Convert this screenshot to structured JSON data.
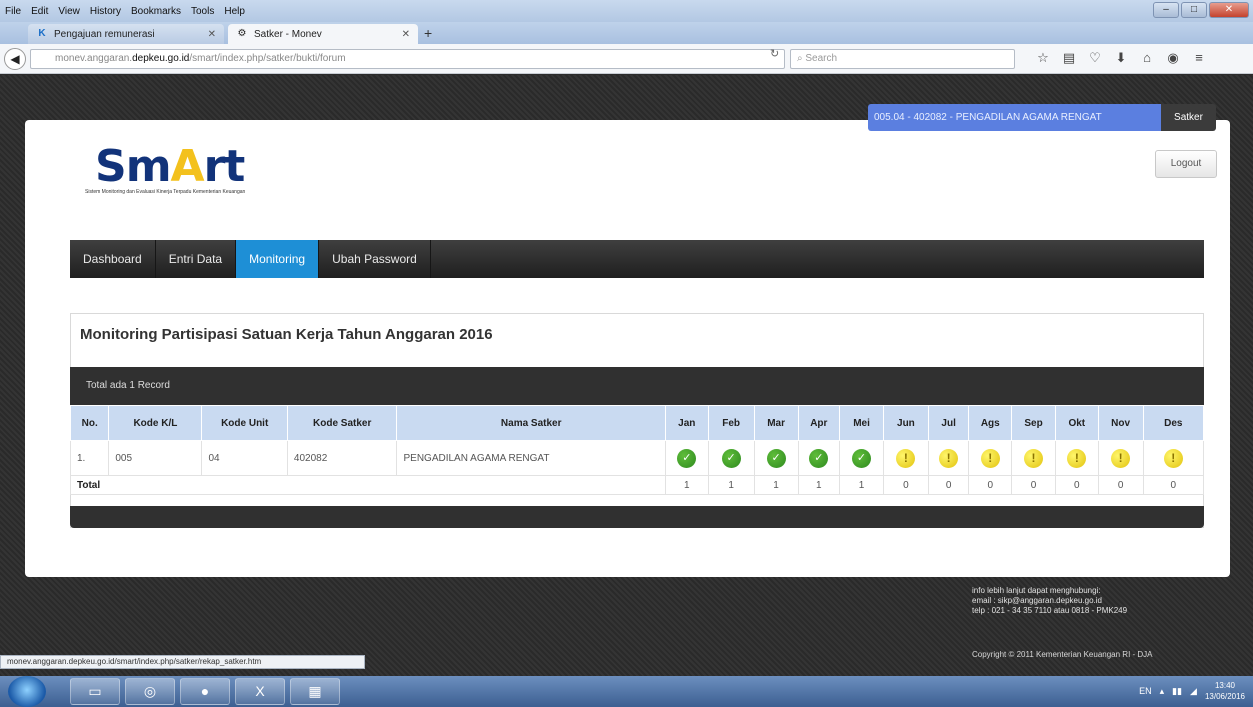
{
  "browser": {
    "menu": [
      "File",
      "Edit",
      "View",
      "History",
      "Bookmarks",
      "Tools",
      "Help"
    ],
    "tabs": [
      {
        "label": "Pengajuan remunerasi",
        "active": false
      },
      {
        "label": "Satker - Monev",
        "active": true
      }
    ],
    "url_prefix": "monev.anggaran.",
    "url_domain": "depkeu.go.id",
    "url_path": "/smart/index.php/satker/bukti/forum",
    "search_placeholder": "Search"
  },
  "header": {
    "satker_badge": "005.04 - 402082 - PENGADILAN AGAMA RENGAT",
    "role": "Satker",
    "logout": "Logout"
  },
  "logo": {
    "text_left": "Sm",
    "text_star": "A",
    "text_right": "rt",
    "subtitle": "Sistem Monitoring dan Evaluasi Kinerja Terpadu Kementerian Keuangan"
  },
  "nav": {
    "items": [
      "Dashboard",
      "Entri Data",
      "Monitoring",
      "Ubah Password"
    ],
    "active_index": 2
  },
  "monitoring": {
    "title": "Monitoring Partisipasi Satuan Kerja Tahun Anggaran 2016",
    "record_text": "Total ada 1 Record",
    "columns": [
      "No.",
      "Kode K/L",
      "Kode Unit",
      "Kode Satker",
      "Nama Satker",
      "Jan",
      "Feb",
      "Mar",
      "Apr",
      "Mei",
      "Jun",
      "Jul",
      "Ags",
      "Sep",
      "Okt",
      "Nov",
      "Des"
    ],
    "rows": [
      {
        "no": "1.",
        "kode_kl": "005",
        "kode_unit": "04",
        "kode_satker": "402082",
        "nama": "PENGADILAN AGAMA RENGAT",
        "months": [
          "ok",
          "ok",
          "ok",
          "ok",
          "ok",
          "warn",
          "warn",
          "warn",
          "warn",
          "warn",
          "warn",
          "warn"
        ]
      }
    ],
    "total_label": "Total",
    "totals": [
      "1",
      "1",
      "1",
      "1",
      "1",
      "0",
      "0",
      "0",
      "0",
      "0",
      "0",
      "0"
    ]
  },
  "footer": {
    "info_lines": [
      "info lebih lanjut dapat menghubungi:",
      "email : sikp@anggaran.depkeu.go.id",
      "telp : 021 - 34 35 7110 atau 0818 - PMK249"
    ],
    "copyright": "Copyright © 2011 Kementerian Keuangan RI - DJA"
  },
  "status_link": "monev.anggaran.depkeu.go.id/smart/index.php/satker/rekap_satker.htm",
  "taskbar": {
    "lang": "EN",
    "time": "13:40",
    "date": "13/06/2016"
  },
  "colors": {
    "nav_active": "#1e8fd6",
    "badge": "#5b7fe0",
    "header_row": "#c9daf1",
    "ok": "#2e8a1f",
    "warn": "#e1c20c"
  }
}
